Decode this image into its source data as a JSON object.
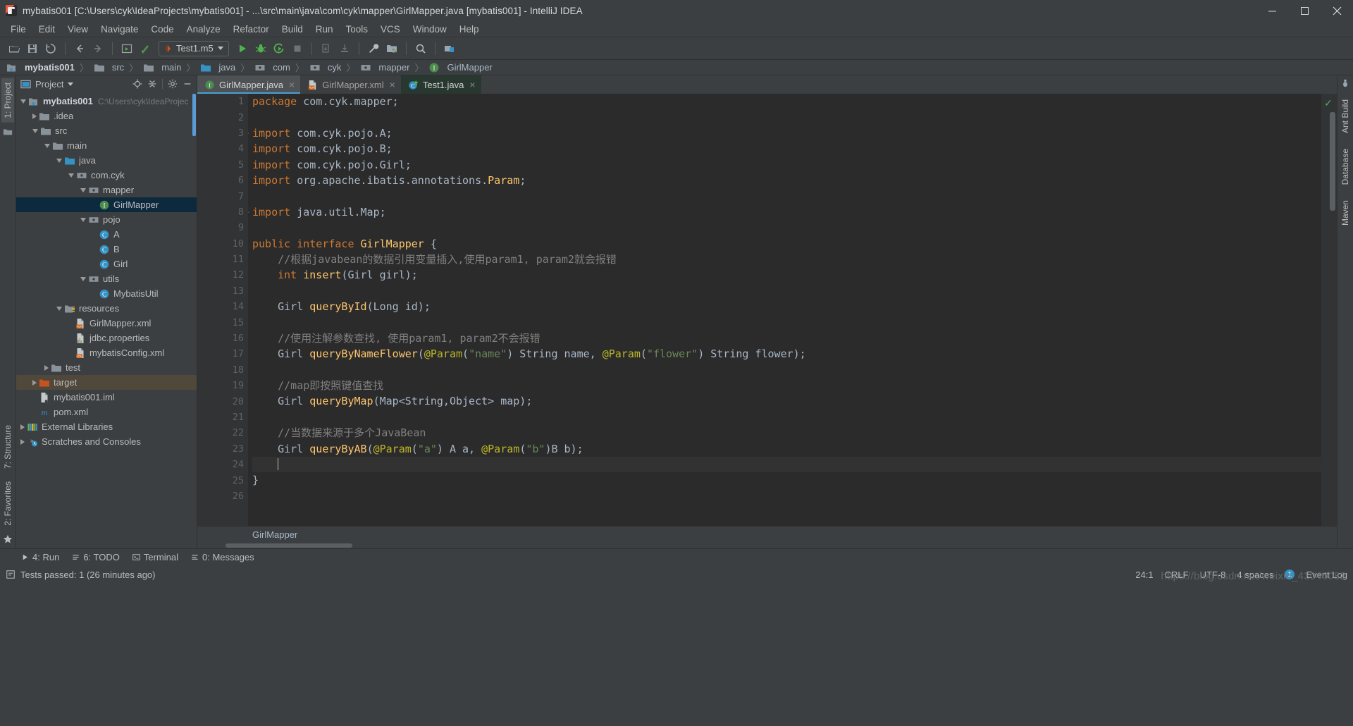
{
  "window": {
    "title": "mybatis001 [C:\\Users\\cyk\\IdeaProjects\\mybatis001] - ...\\src\\main\\java\\com\\cyk\\mapper\\GirlMapper.java [mybatis001] - IntelliJ IDEA",
    "minimize_label": "–",
    "maximize_label": "□",
    "close_label": "×"
  },
  "menu": {
    "items": [
      "File",
      "Edit",
      "View",
      "Navigate",
      "Code",
      "Analyze",
      "Refactor",
      "Build",
      "Run",
      "Tools",
      "VCS",
      "Window",
      "Help"
    ]
  },
  "toolbar": {
    "run_config": "Test1.m5",
    "icons": [
      "open-folder-icon",
      "save-all-icon",
      "sync-icon",
      "back-arrow-icon",
      "forward-arrow-icon",
      "run-anything-icon",
      "compile-icon",
      "run-icon",
      "debug-icon",
      "run-coverage-icon",
      "stop-icon",
      "update-project-icon",
      "commit-icon",
      "settings-wrench-icon",
      "project-structure-icon",
      "search-icon",
      "sdk-icon"
    ]
  },
  "breadcrumb": {
    "items": [
      {
        "label": "mybatis001",
        "icon": "module-icon",
        "bold": true
      },
      {
        "label": "src",
        "icon": "folder-icon",
        "bold": false
      },
      {
        "label": "main",
        "icon": "folder-icon",
        "bold": false
      },
      {
        "label": "java",
        "icon": "source-root-icon",
        "bold": false
      },
      {
        "label": "com",
        "icon": "package-icon",
        "bold": false
      },
      {
        "label": "cyk",
        "icon": "package-icon",
        "bold": false
      },
      {
        "label": "mapper",
        "icon": "package-icon",
        "bold": false
      },
      {
        "label": "GirlMapper",
        "icon": "interface-icon",
        "bold": false
      }
    ],
    "separator": "〉"
  },
  "left_strip": {
    "project_tab": "1: Project",
    "structure_tab": "7: Structure",
    "favorites_tab": "2: Favorites"
  },
  "right_strip": {
    "ant_build_tab": "Ant Build",
    "database_tab": "Database",
    "maven_tab": "Maven"
  },
  "project_panel": {
    "title": "Project",
    "actions": [
      "locate-icon",
      "collapse-all-icon",
      "settings-gear-icon",
      "hide-icon"
    ],
    "tree": [
      {
        "label": "mybatis001",
        "path": "C:\\Users\\cyk\\IdeaProjec",
        "indent": 0,
        "state": "expanded",
        "icon": "module-icon",
        "bold": true,
        "row": "normal"
      },
      {
        "label": ".idea",
        "path": "",
        "indent": 1,
        "state": "collapsed",
        "icon": "folder-icon",
        "bold": false,
        "row": "normal"
      },
      {
        "label": "src",
        "path": "",
        "indent": 1,
        "state": "expanded",
        "icon": "folder-icon",
        "bold": false,
        "row": "normal"
      },
      {
        "label": "main",
        "path": "",
        "indent": 2,
        "state": "expanded",
        "icon": "folder-icon",
        "bold": false,
        "row": "normal"
      },
      {
        "label": "java",
        "path": "",
        "indent": 3,
        "state": "expanded",
        "icon": "source-root-icon",
        "bold": false,
        "row": "normal"
      },
      {
        "label": "com.cyk",
        "path": "",
        "indent": 4,
        "state": "expanded",
        "icon": "package-icon",
        "bold": false,
        "row": "normal"
      },
      {
        "label": "mapper",
        "path": "",
        "indent": 5,
        "state": "expanded",
        "icon": "package-icon",
        "bold": false,
        "row": "normal"
      },
      {
        "label": "GirlMapper",
        "path": "",
        "indent": 6,
        "state": "leaf",
        "icon": "interface-icon",
        "bold": false,
        "row": "selected"
      },
      {
        "label": "pojo",
        "path": "",
        "indent": 5,
        "state": "expanded",
        "icon": "package-icon",
        "bold": false,
        "row": "normal"
      },
      {
        "label": "A",
        "path": "",
        "indent": 6,
        "state": "leaf",
        "icon": "class-icon",
        "bold": false,
        "row": "normal"
      },
      {
        "label": "B",
        "path": "",
        "indent": 6,
        "state": "leaf",
        "icon": "class-icon",
        "bold": false,
        "row": "normal"
      },
      {
        "label": "Girl",
        "path": "",
        "indent": 6,
        "state": "leaf",
        "icon": "class-icon",
        "bold": false,
        "row": "normal"
      },
      {
        "label": "utils",
        "path": "",
        "indent": 5,
        "state": "expanded",
        "icon": "package-icon",
        "bold": false,
        "row": "normal"
      },
      {
        "label": "MybatisUtil",
        "path": "",
        "indent": 6,
        "state": "leaf",
        "icon": "class-icon",
        "bold": false,
        "row": "normal"
      },
      {
        "label": "resources",
        "path": "",
        "indent": 3,
        "state": "expanded",
        "icon": "resource-root-icon",
        "bold": false,
        "row": "normal"
      },
      {
        "label": "GirlMapper.xml",
        "path": "",
        "indent": 4,
        "state": "leaf",
        "icon": "xml-icon",
        "bold": false,
        "row": "normal"
      },
      {
        "label": "jdbc.properties",
        "path": "",
        "indent": 4,
        "state": "leaf",
        "icon": "properties-icon",
        "bold": false,
        "row": "normal"
      },
      {
        "label": "mybatisConfig.xml",
        "path": "",
        "indent": 4,
        "state": "leaf",
        "icon": "xml-icon",
        "bold": false,
        "row": "normal"
      },
      {
        "label": "test",
        "path": "",
        "indent": 2,
        "state": "collapsed",
        "icon": "folder-icon",
        "bold": false,
        "row": "normal"
      },
      {
        "label": "target",
        "path": "",
        "indent": 1,
        "state": "collapsed",
        "icon": "excluded-folder-icon",
        "bold": false,
        "row": "highlight"
      },
      {
        "label": "mybatis001.iml",
        "path": "",
        "indent": 1,
        "state": "leaf",
        "icon": "iml-icon",
        "bold": false,
        "row": "normal"
      },
      {
        "label": "pom.xml",
        "path": "",
        "indent": 1,
        "state": "leaf",
        "icon": "maven-icon",
        "bold": false,
        "row": "normal"
      },
      {
        "label": "External Libraries",
        "path": "",
        "indent": 0,
        "state": "collapsed",
        "icon": "libraries-icon",
        "bold": false,
        "row": "normal"
      },
      {
        "label": "Scratches and Consoles",
        "path": "",
        "indent": 0,
        "state": "collapsed",
        "icon": "scratches-icon",
        "bold": false,
        "row": "normal"
      }
    ]
  },
  "editor": {
    "tabs": [
      {
        "label": "GirlMapper.java",
        "icon": "interface-icon",
        "state": "active",
        "close": "×"
      },
      {
        "label": "GirlMapper.xml",
        "icon": "xml-icon",
        "state": "normal",
        "close": "×"
      },
      {
        "label": "Test1.java",
        "icon": "test-class-icon",
        "state": "modified",
        "close": "×"
      }
    ],
    "bottom_breadcrumb": "GirlMapper",
    "lines": [
      {
        "n": "1",
        "marker": "",
        "fold": "none",
        "tokens": [
          {
            "t": "package ",
            "c": "kw"
          },
          {
            "t": "com.cyk.mapper;",
            "c": "id"
          }
        ]
      },
      {
        "n": "2",
        "marker": "",
        "fold": "none",
        "tokens": []
      },
      {
        "n": "3",
        "marker": "",
        "fold": "start",
        "tokens": [
          {
            "t": "import ",
            "c": "kw"
          },
          {
            "t": "com.cyk.pojo.A;",
            "c": "id"
          }
        ]
      },
      {
        "n": "4",
        "marker": "",
        "fold": "mid",
        "tokens": [
          {
            "t": "import ",
            "c": "kw"
          },
          {
            "t": "com.cyk.pojo.B;",
            "c": "id"
          }
        ]
      },
      {
        "n": "5",
        "marker": "",
        "fold": "mid",
        "tokens": [
          {
            "t": "import ",
            "c": "kw"
          },
          {
            "t": "com.cyk.pojo.Girl;",
            "c": "id"
          }
        ]
      },
      {
        "n": "6",
        "marker": "",
        "fold": "mid",
        "tokens": [
          {
            "t": "import ",
            "c": "kw"
          },
          {
            "t": "org.apache.ibatis.annotations.",
            "c": "id"
          },
          {
            "t": "Param",
            "c": "typ"
          },
          {
            "t": ";",
            "c": "id"
          }
        ]
      },
      {
        "n": "7",
        "marker": "",
        "fold": "mid",
        "tokens": []
      },
      {
        "n": "8",
        "marker": "",
        "fold": "end",
        "tokens": [
          {
            "t": "import ",
            "c": "kw"
          },
          {
            "t": "java.util.Map;",
            "c": "id"
          }
        ]
      },
      {
        "n": "9",
        "marker": "",
        "fold": "none",
        "tokens": []
      },
      {
        "n": "10",
        "marker": "→",
        "fold": "none",
        "tokens": [
          {
            "t": "public interface ",
            "c": "kw"
          },
          {
            "t": "GirlMapper",
            "c": "typ"
          },
          {
            "t": " {",
            "c": "pun"
          }
        ]
      },
      {
        "n": "11",
        "marker": "",
        "fold": "none",
        "tokens": [
          {
            "t": "    //根据javabean的数据引用变量插入,使用param1, param2就会报错",
            "c": "cm"
          }
        ]
      },
      {
        "n": "12",
        "marker": "→",
        "fold": "none",
        "tokens": [
          {
            "t": "    ",
            "c": "pun"
          },
          {
            "t": "int",
            "c": "kw"
          },
          {
            "t": " ",
            "c": "pun"
          },
          {
            "t": "insert",
            "c": "typ"
          },
          {
            "t": "(Girl girl);",
            "c": "id"
          }
        ]
      },
      {
        "n": "13",
        "marker": "",
        "fold": "none",
        "tokens": []
      },
      {
        "n": "14",
        "marker": "→",
        "fold": "none",
        "tokens": [
          {
            "t": "    Girl ",
            "c": "id"
          },
          {
            "t": "queryById",
            "c": "typ"
          },
          {
            "t": "(Long id);",
            "c": "id"
          }
        ]
      },
      {
        "n": "15",
        "marker": "",
        "fold": "none",
        "tokens": []
      },
      {
        "n": "16",
        "marker": "",
        "fold": "none",
        "tokens": [
          {
            "t": "    //使用注解参数查找, 使用param1, param2不会报错",
            "c": "cm"
          }
        ]
      },
      {
        "n": "17",
        "marker": "→",
        "fold": "none",
        "tokens": [
          {
            "t": "    Girl ",
            "c": "id"
          },
          {
            "t": "queryByNameFlower",
            "c": "typ"
          },
          {
            "t": "(",
            "c": "id"
          },
          {
            "t": "@Param",
            "c": "ann"
          },
          {
            "t": "(",
            "c": "id"
          },
          {
            "t": "\"name\"",
            "c": "str"
          },
          {
            "t": ") String name, ",
            "c": "id"
          },
          {
            "t": "@Param",
            "c": "ann"
          },
          {
            "t": "(",
            "c": "id"
          },
          {
            "t": "\"flower\"",
            "c": "str"
          },
          {
            "t": ") String flower);",
            "c": "id"
          }
        ]
      },
      {
        "n": "18",
        "marker": "",
        "fold": "none",
        "tokens": []
      },
      {
        "n": "19",
        "marker": "",
        "fold": "none",
        "tokens": [
          {
            "t": "    //map即按照键值查找",
            "c": "cm"
          }
        ]
      },
      {
        "n": "20",
        "marker": "→",
        "fold": "none",
        "tokens": [
          {
            "t": "    Girl ",
            "c": "id"
          },
          {
            "t": "queryByMap",
            "c": "typ"
          },
          {
            "t": "(Map<String,Object> map);",
            "c": "id"
          }
        ]
      },
      {
        "n": "21",
        "marker": "",
        "fold": "none",
        "tokens": []
      },
      {
        "n": "22",
        "marker": "",
        "fold": "none",
        "tokens": [
          {
            "t": "    //当数据来源于多个JavaBean",
            "c": "cm"
          }
        ]
      },
      {
        "n": "23",
        "marker": "→",
        "fold": "none",
        "tokens": [
          {
            "t": "    Girl ",
            "c": "id"
          },
          {
            "t": "queryByAB",
            "c": "typ"
          },
          {
            "t": "(",
            "c": "id"
          },
          {
            "t": "@Param",
            "c": "ann"
          },
          {
            "t": "(",
            "c": "id"
          },
          {
            "t": "\"a\"",
            "c": "str"
          },
          {
            "t": ") A a, ",
            "c": "id"
          },
          {
            "t": "@Param",
            "c": "ann"
          },
          {
            "t": "(",
            "c": "id"
          },
          {
            "t": "\"b\"",
            "c": "str"
          },
          {
            "t": ")B b);",
            "c": "id"
          }
        ]
      },
      {
        "n": "24",
        "marker": "",
        "fold": "none",
        "current": true,
        "tokens": [
          {
            "t": "    ",
            "c": "pun"
          }
        ]
      },
      {
        "n": "25",
        "marker": "",
        "fold": "none",
        "tokens": [
          {
            "t": "}",
            "c": "pun"
          }
        ]
      },
      {
        "n": "26",
        "marker": "",
        "fold": "none",
        "tokens": []
      }
    ]
  },
  "bottom_tools": [
    {
      "label": "4: Run",
      "icon": "run-icon"
    },
    {
      "label": "6: TODO",
      "icon": "todo-icon"
    },
    {
      "label": "Terminal",
      "icon": "terminal-icon"
    },
    {
      "label": "0: Messages",
      "icon": "messages-icon"
    }
  ],
  "statusbar": {
    "message": "Tests passed: 1 (26 minutes ago)",
    "caret_position": "24:1",
    "line_separator": "CRLF",
    "encoding": "UTF-8",
    "indent": "4 spaces",
    "event_log": "Event Log",
    "event_log_count": "1",
    "watermark": "https://blog.csdn.net/weixin_43046082"
  },
  "colors": {
    "accent": "#4a9fd4",
    "selection": "#0d293e",
    "highlight": "#50483b",
    "keyword": "#cc7832",
    "method": "#ffc66d",
    "annotation": "#bbb529",
    "string": "#6a8759",
    "comment": "#808080",
    "text": "#a9b7c6",
    "editor_bg": "#2b2b2b",
    "chrome_bg": "#3c3f41",
    "gutter_bg": "#313335"
  }
}
